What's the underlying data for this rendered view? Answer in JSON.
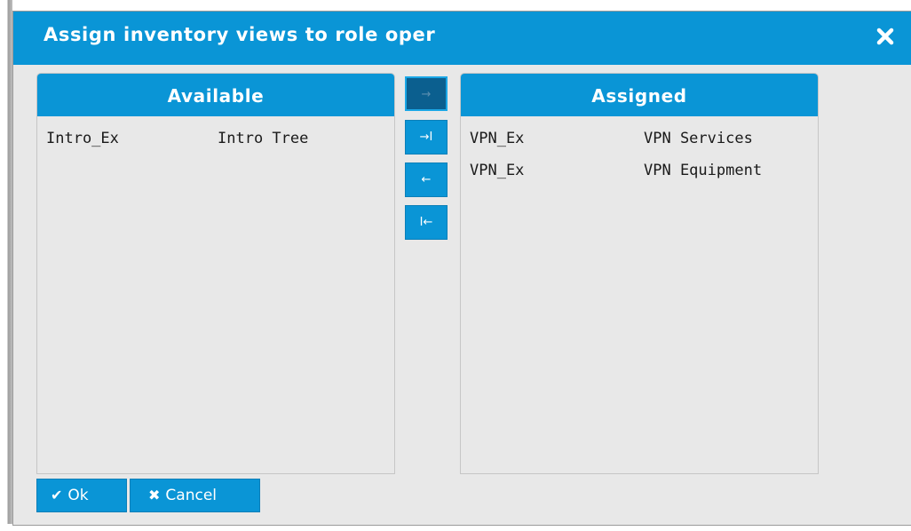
{
  "dialog": {
    "title": "Assign inventory views to role oper",
    "close_icon": "close-x-icon"
  },
  "available": {
    "header": "Available",
    "rows": [
      {
        "id": "Intro_Ex",
        "name": "Intro Tree"
      }
    ]
  },
  "assigned": {
    "header": "Assigned",
    "rows": [
      {
        "id": "VPN_Ex",
        "name": "VPN Services"
      },
      {
        "id": "VPN_Ex",
        "name": "VPN Equipment"
      }
    ]
  },
  "transfer": {
    "assign_selected": "→",
    "assign_all": "→I",
    "unassign_selected": "←",
    "unassign_all": "I←"
  },
  "footer": {
    "ok_label": "Ok",
    "ok_icon": "✔",
    "cancel_label": "Cancel",
    "cancel_icon": "✖"
  },
  "colors": {
    "accent": "#0a95d6",
    "panel_bg": "#e8e8e8",
    "active_button": "#0b5f8f"
  }
}
